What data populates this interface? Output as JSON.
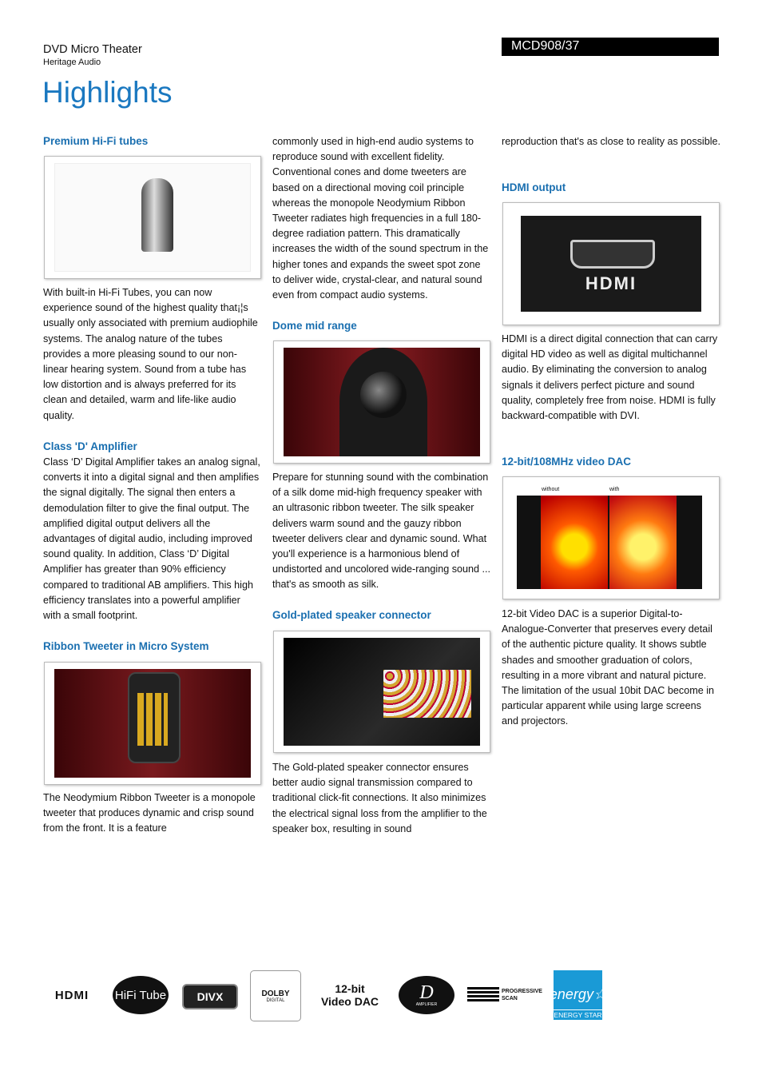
{
  "header": {
    "product_type": "DVD Micro Theater",
    "subtitle": "Heritage Audio",
    "model": "MCD908/37",
    "title": "Highlights"
  },
  "sections": {
    "tubes": {
      "heading": "Premium Hi-Fi tubes",
      "text": "With built-in Hi-Fi Tubes, you can now experience sound of the highest quality that¡¦s usually only associated with premium audiophile systems. The analog nature of the tubes provides a more pleasing sound to our non-linear hearing system. Sound from a tube has low distortion and is always preferred for its clean and detailed, warm and life-like audio quality."
    },
    "classd": {
      "heading": "Class 'D' Amplifier",
      "text": "Class ‘D’ Digital Amplifier takes an analog signal, converts it into a digital signal and then amplifies the signal digitally. The signal then enters a demodulation filter to give the final output. The amplified digital output delivers all the advantages of digital audio, including improved sound quality. In addition, Class ‘D’ Digital Amplifier has greater than 90% efficiency compared to traditional AB amplifiers. This high efficiency translates into a powerful amplifier with a small footprint."
    },
    "ribbon": {
      "heading": "Ribbon Tweeter in Micro System",
      "text": "The Neodymium Ribbon Tweeter is a monopole tweeter that produces dynamic and crisp sound from the front. It is a feature",
      "text_cont": "commonly used in high-end audio systems to reproduce sound with excellent fidelity. Conventional cones and dome tweeters are based on a directional moving coil principle whereas the monopole Neodymium Ribbon Tweeter radiates high frequencies in a full 180-degree radiation pattern. This dramatically increases the width of the sound spectrum in the higher tones and expands the sweet spot zone to deliver wide, crystal-clear, and natural sound even from compact audio systems."
    },
    "dome": {
      "heading": "Dome mid range",
      "text": "Prepare for stunning sound with the combination of a silk dome mid-high frequency speaker with an ultrasonic ribbon tweeter. The silk speaker delivers warm sound and the gauzy ribbon tweeter delivers clear and dynamic sound. What you'll experience is a harmonious blend of undistorted and uncolored wide-ranging sound ... that's as smooth as silk."
    },
    "gold": {
      "heading": "Gold-plated speaker connector",
      "text": "The Gold-plated speaker connector ensures better audio signal transmission compared to traditional click-fit connections. It also minimizes the electrical signal loss from the amplifier to the speaker box, resulting in sound",
      "text_cont": "reproduction that's as close to reality as possible."
    },
    "hdmi": {
      "heading": "HDMI output",
      "image_text": "HDMI",
      "text": "HDMI is a direct digital connection that can carry digital HD video as well as digital multichannel audio. By eliminating the conversion to analog signals it delivers perfect picture and sound quality, completely free from noise. HDMI is fully backward-compatible with DVI."
    },
    "dac": {
      "heading": "12-bit/108MHz video DAC",
      "label_without": "without",
      "label_with": "with",
      "text": "12-bit Video DAC is a superior Digital-to-Analogue-Converter that preserves every detail of the authentic picture quality. It shows subtle shades and smoother graduation of colors, resulting in a more vibrant and natural picture. The limitation of the usual 10bit DAC become in particular apparent while using large screens and projectors."
    }
  },
  "logos": {
    "hdmi": "HDMI",
    "hifitube": "HiFi Tube",
    "divx": "DIVX",
    "dolby": "DOLBY",
    "dolby_sub": "DIGITAL",
    "dac_line1": "12-bit",
    "dac_line2": "Video DAC",
    "amp": "AMPLIFIER",
    "progressive": "PROGRESSIVE SCAN",
    "energy": "ENERGY STAR"
  }
}
